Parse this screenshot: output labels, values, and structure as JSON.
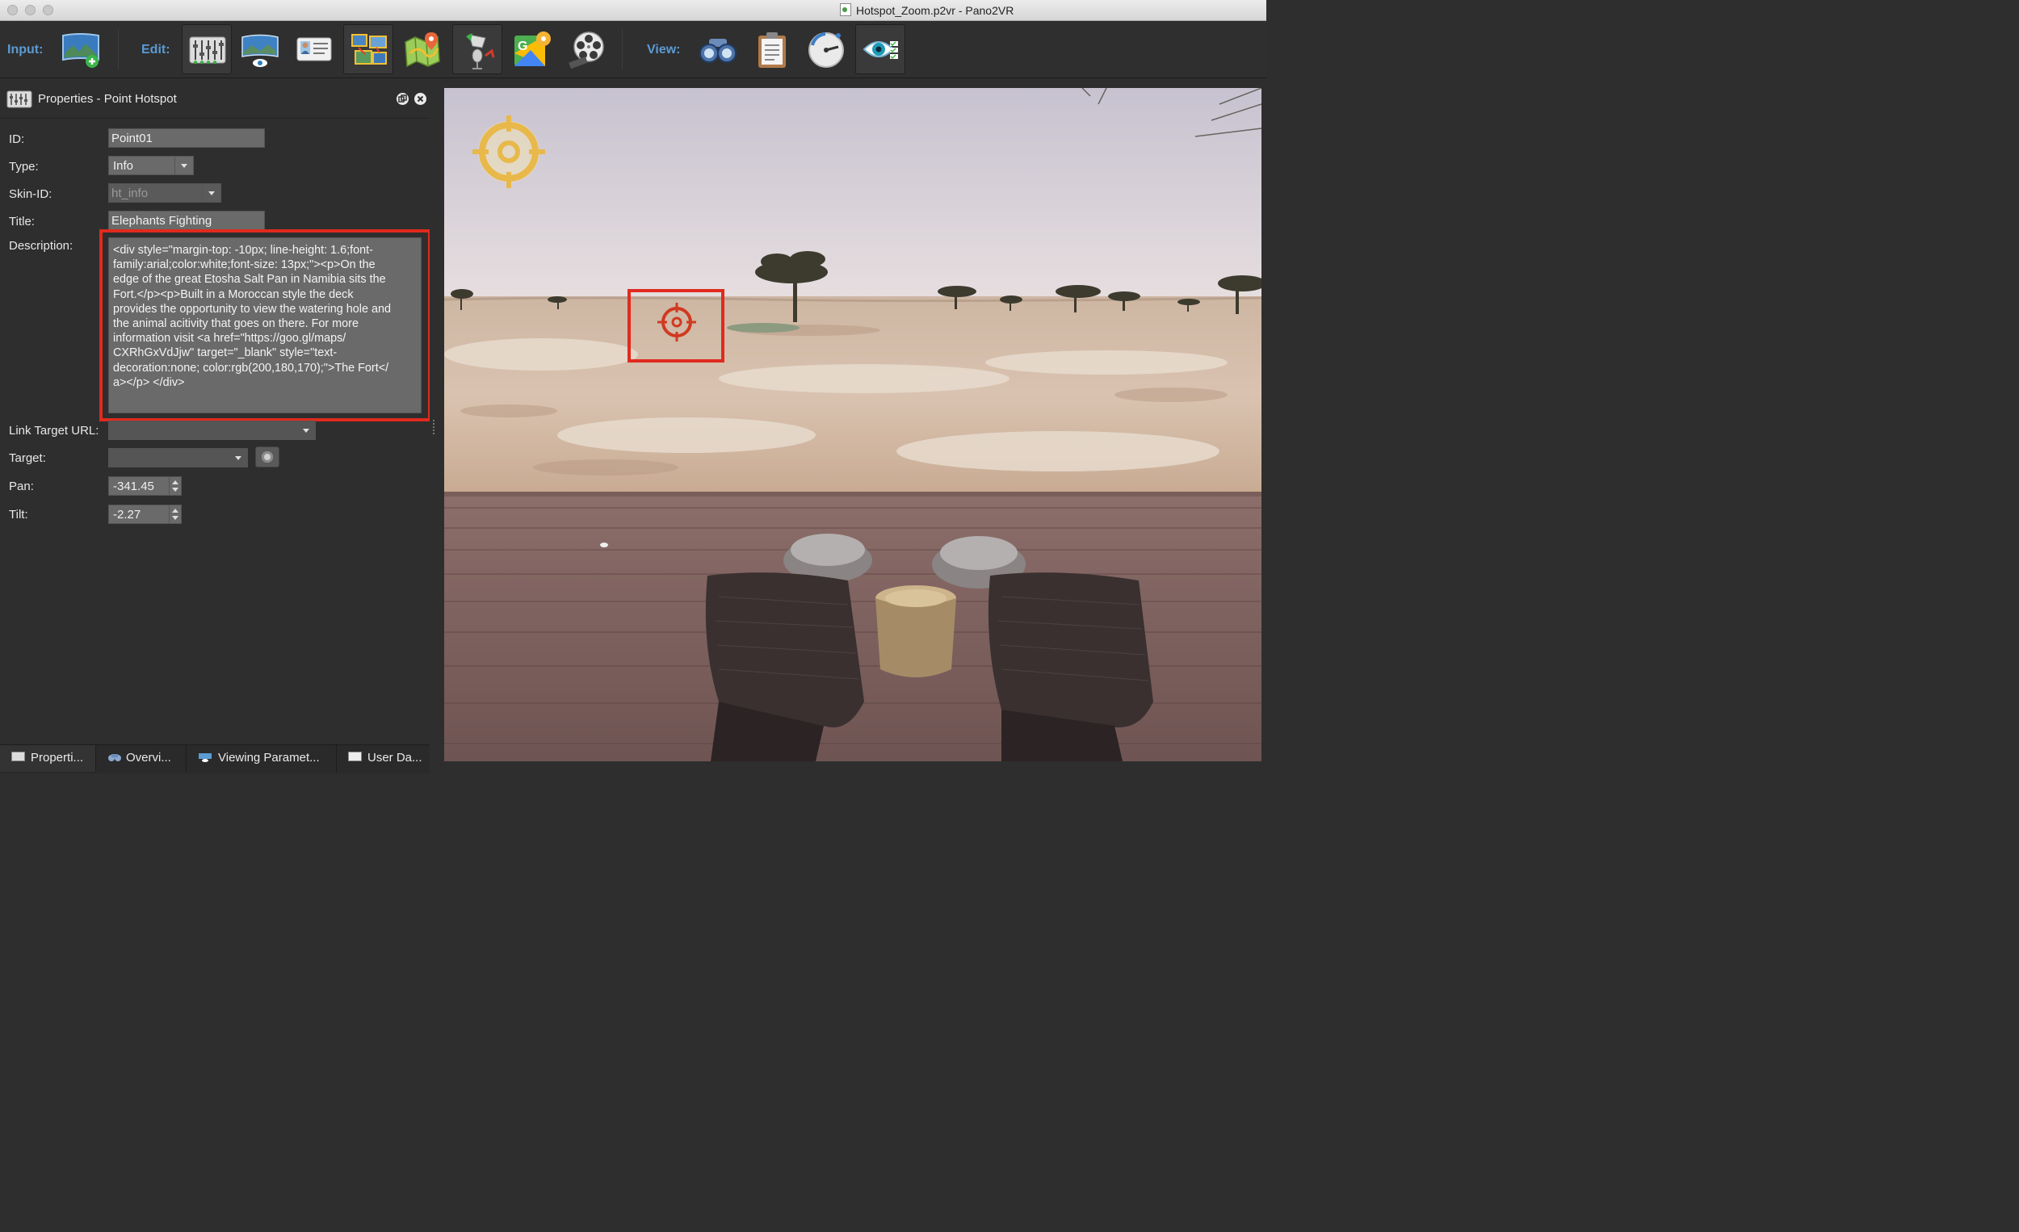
{
  "window": {
    "title": "Hotspot_Zoom.p2vr - Pano2VR"
  },
  "toolbar": {
    "input_label": "Input:",
    "edit_label": "Edit:",
    "view_label": "View:",
    "input_buttons": [
      {
        "icon": "add-panorama-icon"
      }
    ],
    "edit_buttons": [
      {
        "icon": "properties-sliders-icon"
      },
      {
        "icon": "viewing-parameters-icon"
      },
      {
        "icon": "user-data-icon"
      },
      {
        "icon": "patch-icon"
      },
      {
        "icon": "map-icon"
      },
      {
        "icon": "sound-icon"
      },
      {
        "icon": "google-maps-icon"
      },
      {
        "icon": "animation-reel-icon"
      }
    ],
    "view_buttons": [
      {
        "icon": "binoculars-icon"
      },
      {
        "icon": "clipboard-icon"
      },
      {
        "icon": "compass-icon"
      },
      {
        "icon": "eye-check-icon"
      }
    ]
  },
  "properties": {
    "header_title": "Properties - Point Hotspot",
    "labels": {
      "id": "ID:",
      "type": "Type:",
      "skin_id": "Skin-ID:",
      "title": "Title:",
      "description": "Description:",
      "link_target_url": "Link Target URL:",
      "target": "Target:",
      "pan": "Pan:",
      "tilt": "Tilt:"
    },
    "values": {
      "id": "Point01",
      "type": "Info",
      "skin_id": "ht_info",
      "title": "Elephants Fighting",
      "description": "<div style=\"margin-top: -10px; line-height: 1.6;font-\nfamily:arial;color:white;font-size: 13px;\"><p>On the\nedge of the great Etosha Salt Pan in Namibia sits the\nFort.</p><p>Built in a Moroccan style the deck\nprovides the opportunity to view the watering hole and\nthe animal acitivity that goes on there. For more\ninformation visit <a href=\"https://goo.gl/maps/\nCXRhGxVdJjw\" target=\"_blank\" style=\"text-\ndecoration:none; color:rgb(200,180,170);\">The Fort</\na></p> </div>",
      "link_target_url": "",
      "target": "",
      "pan": "-341.45",
      "tilt": "-2.27"
    }
  },
  "bottom_tabs": [
    {
      "label": "Properti...",
      "icon": "properties-icon"
    },
    {
      "label": "Overvi...",
      "icon": "binoculars-icon"
    },
    {
      "label": "Viewing Paramet...",
      "icon": "viewing-parameters-icon"
    },
    {
      "label": "User Da...",
      "icon": "user-data-icon"
    }
  ],
  "colors": {
    "accent_label": "#5b9bd5",
    "highlight_frame": "#e02a1e",
    "hotspot_default": "#e8b84a",
    "hotspot_selected": "#d03a20"
  }
}
